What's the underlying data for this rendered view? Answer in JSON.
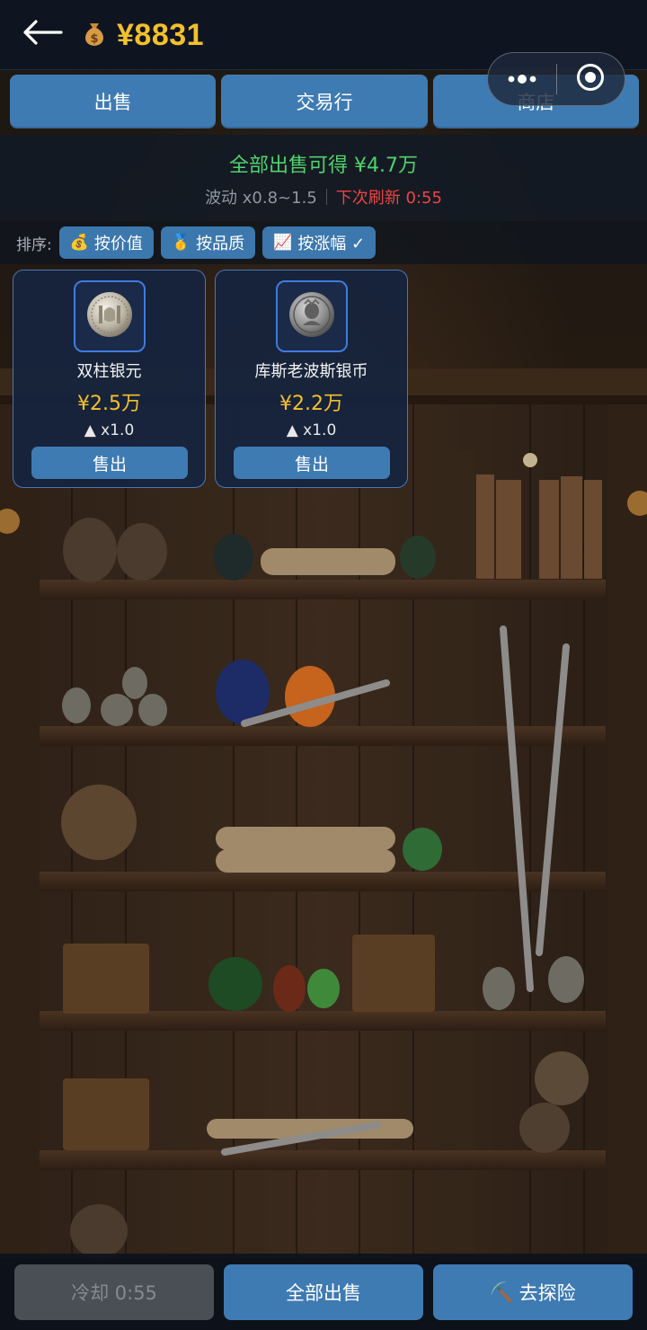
{
  "header": {
    "back_icon": "arrow-left-icon",
    "money_icon": "money-bag-icon",
    "money_amount": "¥8831",
    "menu_icon": "more-dots-icon",
    "close_icon": "target-circle-icon"
  },
  "tabs": [
    {
      "label": "出售"
    },
    {
      "label": "交易行"
    },
    {
      "label": "商店"
    }
  ],
  "summary": {
    "total_text": "全部出售可得 ¥4.7万",
    "fluctuation": "波动 x0.8~1.5",
    "next_refresh": "下次刷新 0:55"
  },
  "sort": {
    "label": "排序:",
    "options": [
      {
        "icon": "💰",
        "label": "按价值"
      },
      {
        "icon": "🥇",
        "label": "按品质"
      },
      {
        "icon": "📈",
        "label": "按涨幅 ✓"
      }
    ]
  },
  "items": [
    {
      "name": "双柱银元",
      "price": "¥2.5万",
      "trend": "▲ x1.0",
      "sell_label": "售出",
      "icon": "silver-coin-icon"
    },
    {
      "name": "库斯老波斯银币",
      "price": "¥2.2万",
      "trend": "▲ x1.0",
      "sell_label": "售出",
      "icon": "persian-coin-icon"
    }
  ],
  "bottom": {
    "cooldown": "冷却 0:55",
    "sell_all": "全部出售",
    "explore_icon": "⛏️",
    "explore": "去探险"
  },
  "colors": {
    "accent_blue": "#3f7bb3",
    "gold": "#f3c02c",
    "green": "#4fd26c",
    "red": "#ee4444"
  }
}
